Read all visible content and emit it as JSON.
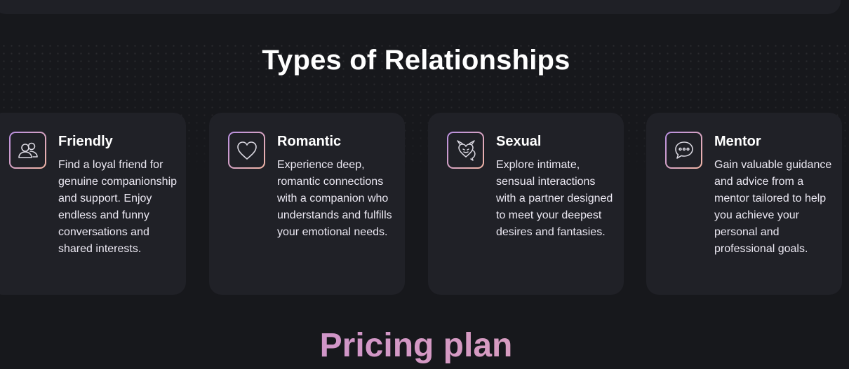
{
  "section": {
    "title": "Types of Relationships"
  },
  "cards": [
    {
      "icon": "friends-icon",
      "title": "Friendly",
      "description": "Find a loyal friend for genuine companionship and support. Enjoy endless and funny conversations and shared interests."
    },
    {
      "icon": "heart-icon",
      "title": "Romantic",
      "description": "Experience deep, romantic connections with a companion who understands and fulfills your emotional needs."
    },
    {
      "icon": "devil-heart-icon",
      "title": "Sexual",
      "description": "Explore intimate, sensual interactions with a partner designed to meet your deepest desires and fantasies."
    },
    {
      "icon": "chat-bubble-icon",
      "title": "Mentor",
      "description": "Gain valuable guidance and advice from a mentor tailored to help you achieve your personal and professional goals."
    }
  ],
  "pricing": {
    "title": "Pricing plan"
  },
  "colors": {
    "background": "#17181c",
    "card": "#202127",
    "accent_start": "#b88ee0",
    "accent_end": "#f3b7a6"
  }
}
